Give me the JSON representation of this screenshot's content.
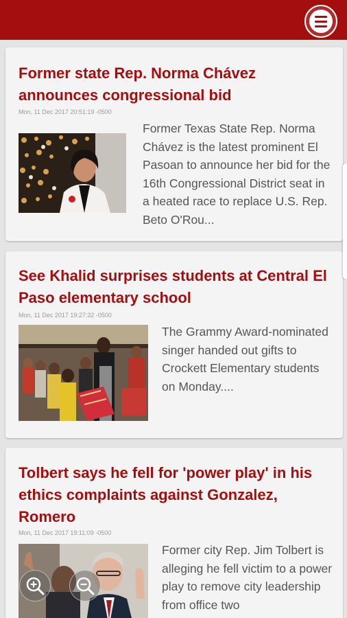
{
  "app": {
    "accent_color": "#a50e0e",
    "menu_icon": "hamburger-menu-icon"
  },
  "articles": [
    {
      "title": "Former state Rep. Norma Chávez announces congressional bid",
      "timestamp": "Mon, 11 Dec 2017 20:51:19 -0500",
      "excerpt": "Former Texas State Rep. Norma Chávez is the latest prominent El Pasoan to announce her bid for the 16th Congressional District seat in a heated race to replace U.S. Rep. Beto O'Rou..."
    },
    {
      "title": "See Khalid surprises students at Central El Paso elementary school",
      "timestamp": "Mon, 11 Dec 2017 19:27:32 -0500",
      "excerpt": "The Grammy Award-nominated singer handed out gifts to Crockett Elementary students on Monday...."
    },
    {
      "title": "Tolbert says he fell for 'power play' in his ethics complaints against Gonzalez, Romero",
      "timestamp": "Mon, 11 Dec 2017 19:11:09 -0500",
      "excerpt": "Former city Rep. Jim Tolbert is alleging he fell victim to a power play to remove city leadership from office two"
    }
  ],
  "zoom_controls": {
    "zoom_in_icon": "zoom-in-icon",
    "zoom_out_icon": "zoom-out-icon"
  }
}
